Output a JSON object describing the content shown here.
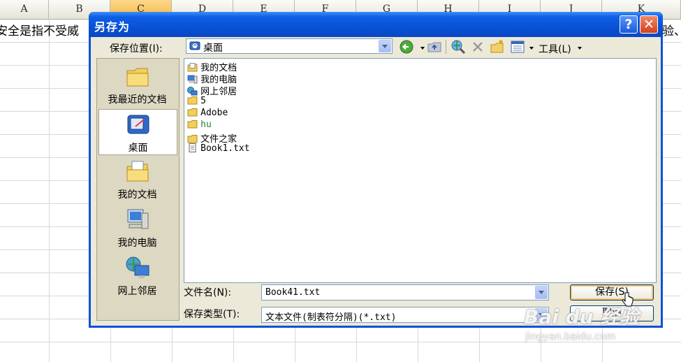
{
  "sheet": {
    "columns": [
      "A",
      "B",
      "C",
      "D",
      "E",
      "F",
      "G",
      "H",
      "I",
      "J",
      "K"
    ],
    "active_column": "C",
    "row1_left_text": "安全是指不受威",
    "row1_right_text": "验、"
  },
  "dialog": {
    "title": "另存为",
    "help_label": "?",
    "close_label": "✕",
    "location_label": "保存位置(I):",
    "location_value": "桌面",
    "tools_label": "工具(L)",
    "places": [
      {
        "label": "我最近的文档",
        "icon": "recent-docs-icon"
      },
      {
        "label": "桌面",
        "icon": "desktop-icon",
        "selected": true
      },
      {
        "label": "我的文档",
        "icon": "my-documents-icon"
      },
      {
        "label": "我的电脑",
        "icon": "my-computer-icon"
      },
      {
        "label": "网上邻居",
        "icon": "network-places-icon"
      }
    ],
    "files": [
      {
        "name": "我的文档",
        "icon": "my-documents-icon"
      },
      {
        "name": "我的电脑",
        "icon": "my-computer-icon"
      },
      {
        "name": "网上邻居",
        "icon": "network-places-icon"
      },
      {
        "name": "5",
        "icon": "folder-icon"
      },
      {
        "name": "Adobe",
        "icon": "folder-icon"
      },
      {
        "name": "hu",
        "icon": "folder-icon",
        "color": "#2e7d32"
      },
      {
        "name": "文件之家",
        "icon": "folder-icon"
      },
      {
        "name": "Book1.txt",
        "icon": "text-file-icon"
      }
    ],
    "filename_label": "文件名(N):",
    "filename_value": "Book41.txt",
    "filetype_label": "保存类型(T):",
    "filetype_value": "文本文件(制表符分隔)(*.txt)",
    "save_label": "保存(S)",
    "cancel_label": "取消"
  },
  "watermark": {
    "brand": "Bai du 经验",
    "url": "jingyan.baidu.com"
  },
  "colors": {
    "titlebar": "#0852d6",
    "dialog_bg": "#ece9d8",
    "places_bg": "#dcd8c2",
    "field_border": "#7f9db9"
  }
}
